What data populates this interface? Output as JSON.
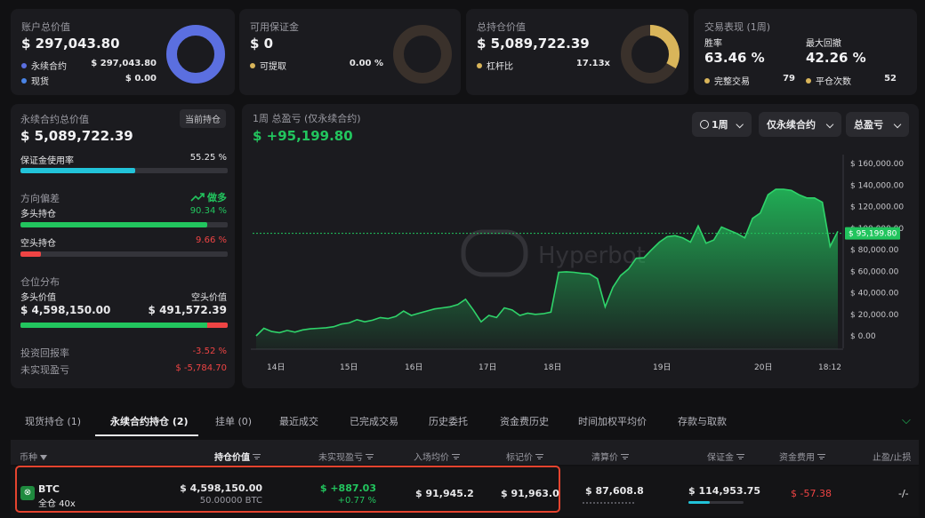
{
  "colors": {
    "accent_blue": "#5b6fe0",
    "green": "#22c55e",
    "red": "#ef4444",
    "gold": "#d9b55a",
    "cyan": "#22c3d9",
    "highlight_red": "#e5442f"
  },
  "account": {
    "title": "账户总价值",
    "value": "$ 297,043.80",
    "rows": [
      {
        "label": "永续合约",
        "value": "$ 297,043.80"
      },
      {
        "label": "现货",
        "value": "$ 0.00"
      }
    ]
  },
  "margin": {
    "title": "可用保证金",
    "value": "$ 0",
    "row": {
      "label": "可提取",
      "value": "0.00 %"
    }
  },
  "positions_value": {
    "title": "总持仓价值",
    "value": "$ 5,089,722.39",
    "row": {
      "label": "杠杆比",
      "value": "17.13x"
    }
  },
  "performance": {
    "title": "交易表现 (1周)",
    "win_label": "胜率",
    "win_value": "63.46 %",
    "dd_label": "最大回撤",
    "dd_value": "42.26 %",
    "trades_label": "完整交易",
    "trades_value": "79",
    "close_label": "平仓次数",
    "close_value": "52"
  },
  "perp": {
    "title": "永续合约总价值",
    "badge": "当前持仓",
    "value": "$ 5,089,722.39",
    "usage_label": "保证金使用率",
    "usage_value": "55.25 %",
    "usage_fraction": 0.5525,
    "bias_label": "方向偏差",
    "bias_value": "做多",
    "long_label": "多头持仓",
    "long_value": "90.34 %",
    "long_fraction": 0.9034,
    "short_label": "空头持仓",
    "short_value": "9.66 %",
    "short_fraction": 0.0966,
    "dist_label": "仓位分布",
    "long_val_label": "多头价值",
    "short_val_label": "空头价值",
    "long_val": "$ 4,598,150.00",
    "short_val": "$ 491,572.39",
    "roi_label": "投资回报率",
    "roi_value": "-3.52 %",
    "upnl_label": "未实现盈亏",
    "upnl_value": "$ -5,784.70"
  },
  "pnl_chart": {
    "title": "1周 总盈亏 (仅永续合约)",
    "value": "$ +95,199.80",
    "controls": {
      "period": "1周",
      "scope": "仅永续合约",
      "metric": "总盈亏"
    },
    "watermark": "Hyperbot"
  },
  "chart_data": {
    "type": "area",
    "title": "1周 总盈亏 (仅永续合约)",
    "ylim": [
      -10000,
      170000
    ],
    "yticks": [
      "$ 160,000.00",
      "$ 140,000.00",
      "$ 120,000.00",
      "$ 100,000.00",
      "$ 80,000.00",
      "$ 60,000.00",
      "$ 40,000.00",
      "$ 20,000.00",
      "$ 0.00"
    ],
    "ytick_values": [
      160000,
      140000,
      120000,
      100000,
      80000,
      60000,
      40000,
      20000,
      0
    ],
    "xticks": [
      "14日",
      "15日",
      "16日",
      "17日",
      "18日",
      "19日",
      "20日",
      "18:12"
    ],
    "current_label": "$ 95,199.80",
    "current_value": 95199.8,
    "series": [
      {
        "values": [
          0,
          7000,
          4000,
          3000,
          5000,
          3500,
          5500,
          6500,
          7000,
          7500,
          8500,
          11000,
          12000,
          15000,
          13000,
          14500,
          17000,
          16000,
          18000,
          23000,
          19000,
          21000,
          23000,
          25000,
          26000,
          27000,
          29000,
          34000,
          24000,
          13000,
          19000,
          17000,
          26000,
          24000,
          19000,
          21000,
          20000,
          20500,
          22000,
          59000,
          59500,
          59000,
          58000,
          57500,
          53000,
          27000,
          45000,
          56000,
          62000,
          72000,
          72500,
          80000,
          87000,
          92000,
          93000,
          91000,
          87000,
          102000,
          86000,
          89000,
          101000,
          98000,
          95000,
          91000,
          109000,
          114000,
          131000,
          136000,
          136000,
          135000,
          131000,
          128000,
          128000,
          124000,
          83000,
          97000
        ]
      }
    ]
  },
  "tabs": [
    "现货持仓 (1)",
    "永续合约持仓 (2)",
    "挂单 (0)",
    "最近成交",
    "已完成交易",
    "历史委托",
    "资金费历史",
    "时间加权平均价",
    "存款与取款"
  ],
  "active_tab_index": 1,
  "table": {
    "headers": [
      "币种",
      "持仓价值",
      "未实现盈亏",
      "入场均价",
      "标记价",
      "清算价",
      "保证金",
      "资金费用",
      "止盈/止损"
    ],
    "row": {
      "coin": "BTC",
      "mode": "全仓 40x",
      "value": "$ 4,598,150.00",
      "size": "50.00000 BTC",
      "pnl": "$ +887.03",
      "pnl_pct": "+0.77 %",
      "entry": "$ 91,945.2",
      "mark": "$ 91,963.0",
      "liq": "$ 87,608.8",
      "margin": "$ 114,953.75",
      "funding": "$ -57.38",
      "tpsl": "-/-"
    }
  }
}
